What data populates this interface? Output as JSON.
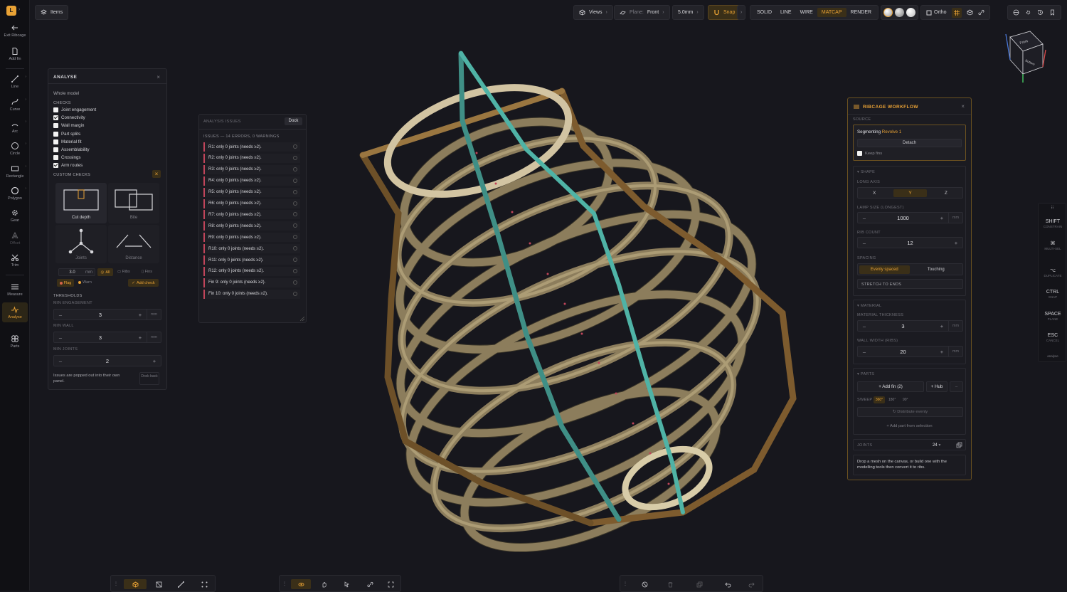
{
  "app": {
    "logo_letter": "L",
    "items_label": "Items"
  },
  "left_tools": [
    {
      "id": "exit",
      "label": "Exit Ribcage",
      "icon": "arrow-left-icon"
    },
    {
      "id": "addfin",
      "label": "Add fin",
      "icon": "document-icon"
    },
    {
      "id": "line",
      "label": "Line",
      "icon": "line-icon"
    },
    {
      "id": "curve",
      "label": "Curve",
      "icon": "curve-icon"
    },
    {
      "id": "arc",
      "label": "Arc",
      "icon": "arc-icon"
    },
    {
      "id": "circle",
      "label": "Circle",
      "icon": "circle-icon"
    },
    {
      "id": "rectangle",
      "label": "Rectangle",
      "icon": "rectangle-icon"
    },
    {
      "id": "polygon",
      "label": "Polygon",
      "icon": "polygon-icon"
    },
    {
      "id": "gear",
      "label": "Gear",
      "icon": "gear-icon"
    },
    {
      "id": "offset",
      "label": "Offset",
      "icon": "offset-icon"
    },
    {
      "id": "trim",
      "label": "Trim",
      "icon": "scissors-icon"
    },
    {
      "id": "measure",
      "label": "Measure",
      "icon": "ruler-icon"
    },
    {
      "id": "analyse",
      "label": "Analyse",
      "icon": "pulse-icon"
    },
    {
      "id": "parts",
      "label": "Parts",
      "icon": "parts-icon"
    }
  ],
  "topbar": {
    "views": "Views",
    "plane_label": "Plane:",
    "plane_value": "Front",
    "grid": "5.0mm",
    "snap": "Snap",
    "modes": [
      "SOLID",
      "LINE",
      "WIRE",
      "MATCAP",
      "RENDER"
    ],
    "active_mode": "MATCAP",
    "ortho": "Ortho"
  },
  "viewcube": {
    "face_top": "Front",
    "face_bottom": "Bottom"
  },
  "analyse": {
    "title": "ANALYSE",
    "scope": "Whole model",
    "checks_title": "CHECKS",
    "checks": [
      {
        "label": "Joint engagement",
        "checked": false
      },
      {
        "label": "Connectivity",
        "checked": true
      },
      {
        "label": "Wall margin",
        "checked": false
      },
      {
        "label": "Part splits",
        "checked": false
      },
      {
        "label": "Material fit",
        "checked": false
      },
      {
        "label": "Assemblability",
        "checked": false
      },
      {
        "label": "Crossings",
        "checked": false
      },
      {
        "label": "Arm routes",
        "checked": true
      }
    ],
    "custom_title": "CUSTOM CHECKS",
    "custom_cards": [
      "Cut depth",
      "Bite",
      "Joints",
      "Distance"
    ],
    "custom_value": "3.0",
    "custom_unit": "mm",
    "scope_all": "All",
    "scope_ribs": "Ribs",
    "scope_fins": "Fins",
    "flag": "Flag",
    "warn": "Warn",
    "add_check": "Add check",
    "thresholds_title": "THRESHOLDS",
    "min_engagement_label": "MIN ENGAGEMENT",
    "min_engagement": "3",
    "min_wall_label": "MIN WALL",
    "min_wall": "3",
    "min_joints_label": "MIN JOINTS",
    "min_joints": "2",
    "unit": "mm",
    "note": "Issues are popped out into their own panel.",
    "dock_back": "Dock back"
  },
  "issues": {
    "title": "ANALYSIS ISSUES",
    "dock": "Dock",
    "summary": "ISSUES — 14 ERRORS, 0 WARNINGS",
    "items": [
      "R1: only 0 joints (needs ≥2).",
      "R2: only 0 joints (needs ≥2).",
      "R3: only 0 joints (needs ≥2).",
      "R4: only 0 joints (needs ≥2).",
      "R5: only 0 joints (needs ≥2).",
      "R6: only 0 joints (needs ≥2).",
      "R7: only 0 joints (needs ≥2).",
      "R8: only 0 joints (needs ≥2).",
      "R9: only 0 joints (needs ≥2).",
      "R10: only 0 joints (needs ≥2).",
      "R11: only 0 joints (needs ≥2).",
      "R12: only 0 joints (needs ≥2).",
      "Fin 9: only 0 joints (needs ≥2).",
      "Fin 10: only 0 joints (needs ≥2)."
    ]
  },
  "ribcage": {
    "title": "RIBCAGE WORKFLOW",
    "source_title": "SOURCE",
    "segmenting": "Segmenting",
    "source_name": "Revolve 1",
    "detach": "Detach",
    "keep_fins": "Keep fins",
    "shape_title": "SHAPE",
    "long_axis_label": "LONG AXIS",
    "axes": [
      "X",
      "Y",
      "Z"
    ],
    "active_axis": "Y",
    "lamp_size_label": "LAMP SIZE (LONGEST)",
    "lamp_size": "1000",
    "rib_count_label": "RIB COUNT",
    "rib_count": "12",
    "spacing_label": "SPACING",
    "spacing_even": "Evenly spaced",
    "spacing_touch": "Touching",
    "stretch": "STRETCH TO ENDS",
    "material_title": "MATERIAL",
    "thickness_label": "MATERIAL THICKNESS",
    "thickness": "3",
    "wall_label": "WALL WIDTH (RIBS)",
    "wall": "20",
    "unit": "mm",
    "parts_title": "PARTS",
    "add_fin": "+ Add fin (2)",
    "hub": "+ Hub",
    "sweep_label": "SWEEP",
    "sweeps": [
      "360°",
      "180°",
      "90°"
    ],
    "distribute": "Distribute evenly",
    "add_part": "+ Add part from selection",
    "joints_label": "JOINTS",
    "joints_value": "24",
    "hint": "Drop a mesh on the canvas, or build one with the modelling tools then convert it to ribs."
  },
  "shortcuts": [
    {
      "key": "SHIFT",
      "desc": "CONSTRAIN"
    },
    {
      "key": "⌘",
      "desc": "MULTI-SEL"
    },
    {
      "key": "⌥",
      "desc": "DUPLICATE"
    },
    {
      "key": "CTRL",
      "desc": "SNAP"
    },
    {
      "key": "SPACE",
      "desc": "PLANE"
    },
    {
      "key": "ESC",
      "desc": "CANCEL"
    }
  ],
  "shortcut_footer": "analyse",
  "colors": {
    "accent": "#e9a235",
    "rib": "#d2c4a2",
    "fin": "#4fb3a6",
    "error": "#c0455a"
  }
}
